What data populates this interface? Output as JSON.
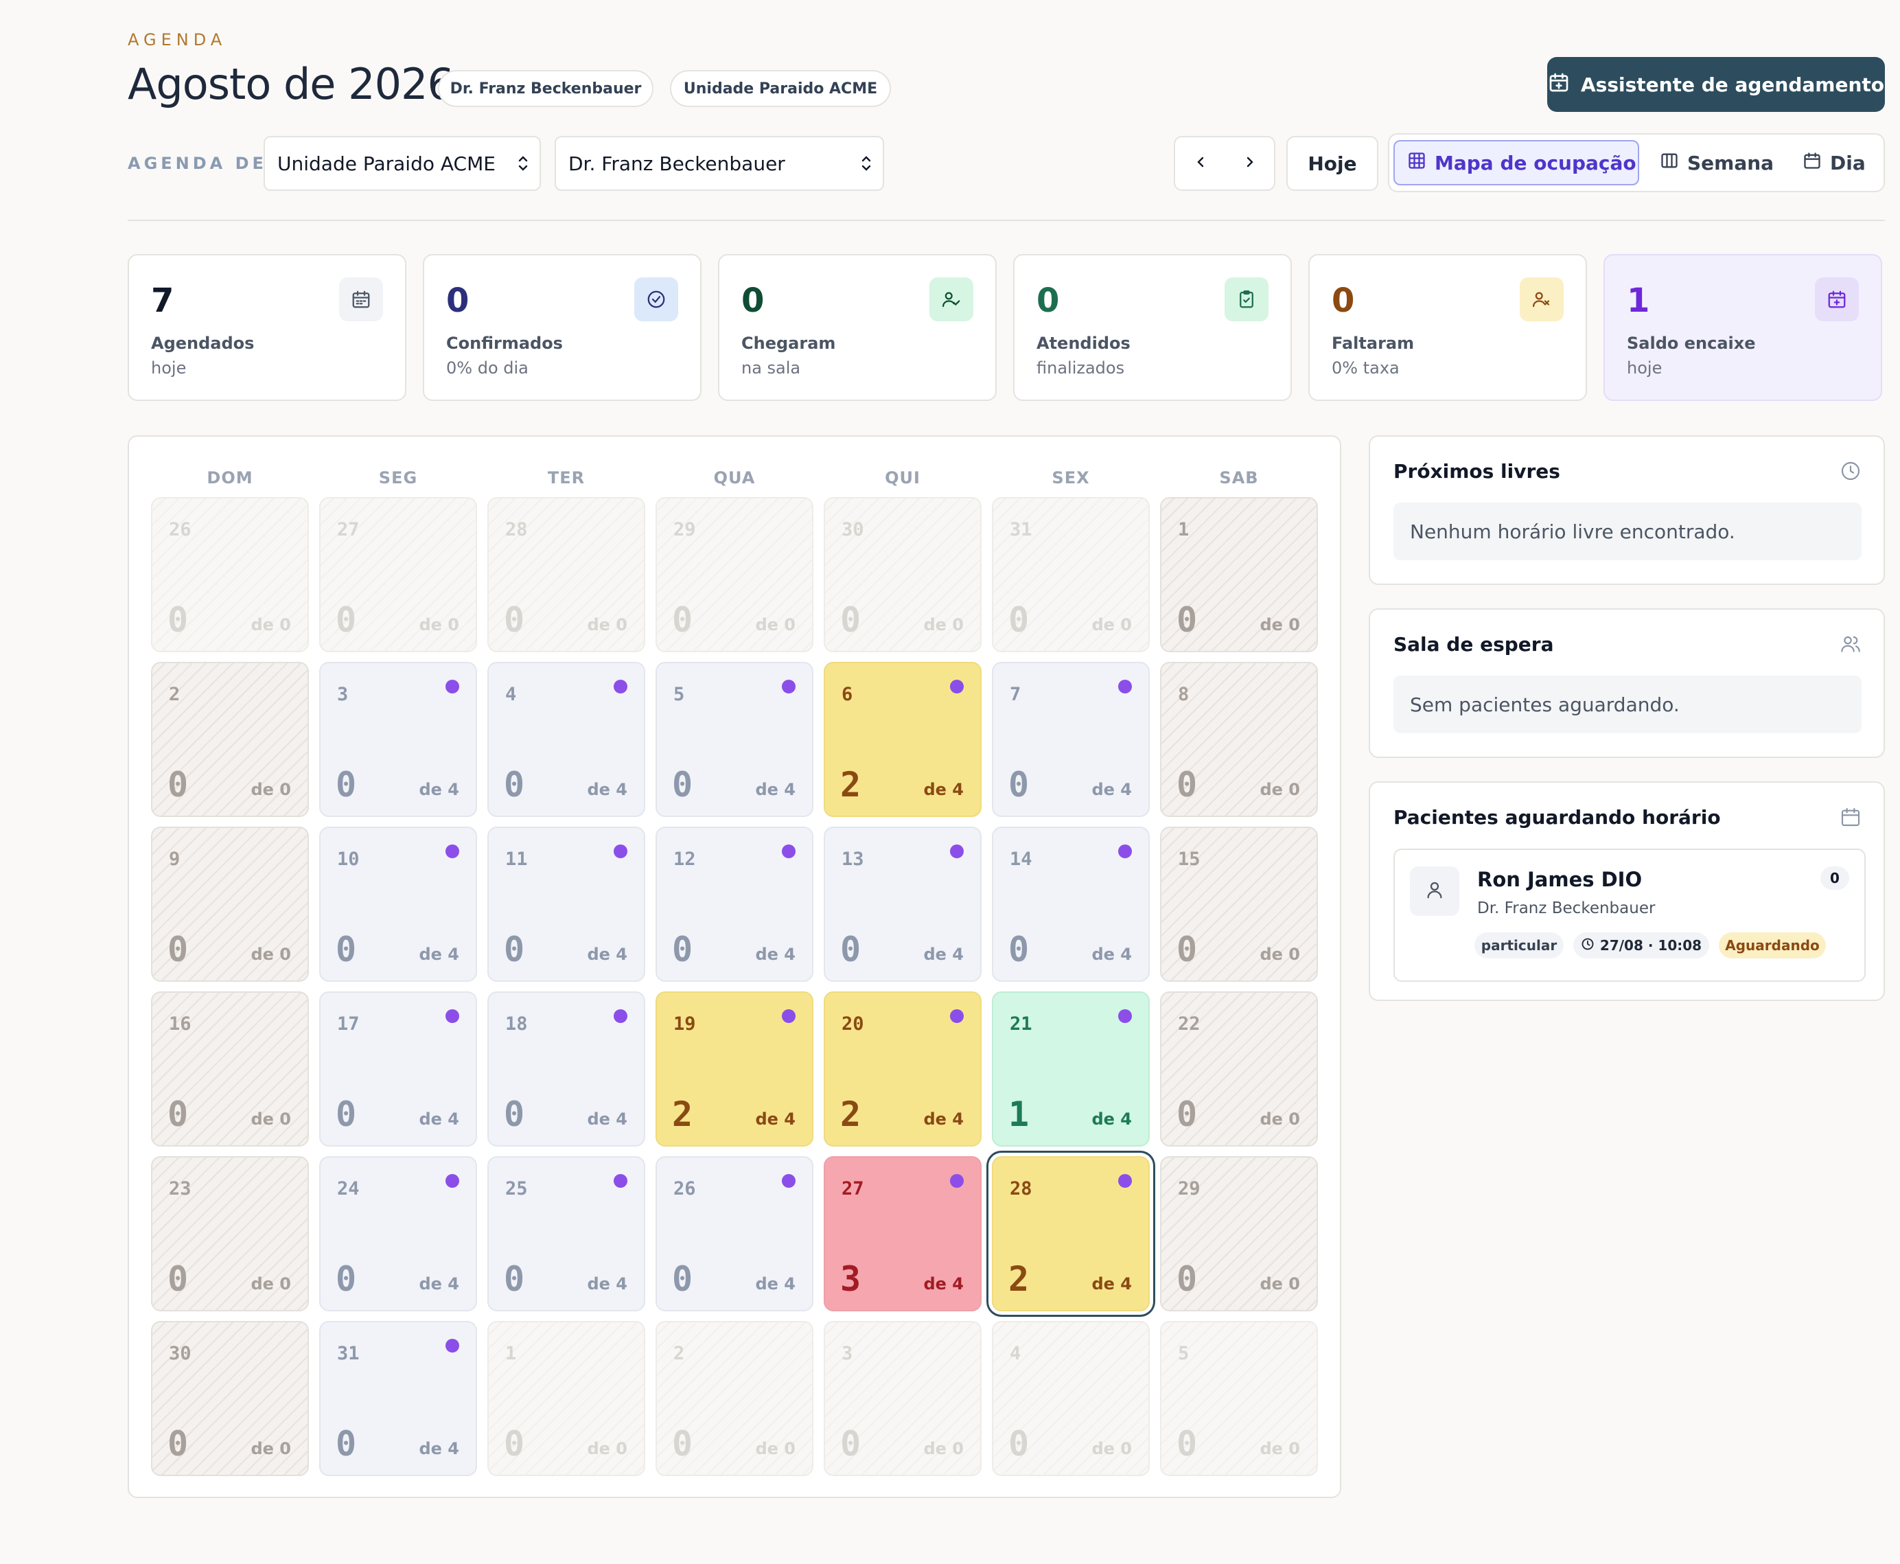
{
  "header": {
    "eyebrow": "AGENDA",
    "title": "Agosto de 2026",
    "chips": [
      "Dr. Franz Beckenbauer",
      "Unidade Paraido ACME"
    ],
    "assistant_button": "Assistente de agendamento"
  },
  "filters": {
    "label": "AGENDA DE",
    "unit_select": "Unidade Paraido ACME",
    "doctor_select": "Dr. Franz Beckenbauer"
  },
  "toolbar": {
    "today": "Hoje",
    "views": [
      {
        "label": "Mapa de ocupação",
        "icon": "grid-icon",
        "active": true
      },
      {
        "label": "Semana",
        "icon": "columns-icon",
        "active": false
      },
      {
        "label": "Dia",
        "icon": "calendar-icon",
        "active": false
      }
    ]
  },
  "stats": [
    {
      "value": "7",
      "label": "Agendados",
      "sub": "hoje",
      "color": "#111827",
      "icon": "calendar-icon",
      "icon_bg": "#f1f3f7"
    },
    {
      "value": "0",
      "label": "Confirmados",
      "sub": "0% do dia",
      "color": "#2c2f7a",
      "icon": "check-circle-icon",
      "icon_bg": "#dbe9fb"
    },
    {
      "value": "0",
      "label": "Chegaram",
      "sub": "na sala",
      "color": "#0f4d34",
      "icon": "user-check-icon",
      "icon_bg": "#d6f5e3"
    },
    {
      "value": "0",
      "label": "Atendidos",
      "sub": "finalizados",
      "color": "#1d6e4f",
      "icon": "clipboard-check-icon",
      "icon_bg": "#d6f5e3"
    },
    {
      "value": "0",
      "label": "Faltaram",
      "sub": "0% taxa",
      "color": "#8a4a12",
      "icon": "user-x-icon",
      "icon_bg": "#fbefc4"
    },
    {
      "value": "1",
      "label": "Saldo encaixe",
      "sub": "hoje",
      "color": "#6d28d9",
      "icon": "calendar-plus-icon",
      "icon_bg": "#e7defa"
    }
  ],
  "calendar": {
    "weekdays": [
      "DOM",
      "SEG",
      "TER",
      "QUA",
      "QUI",
      "SEX",
      "SAB"
    ],
    "weeks": [
      [
        {
          "day": "26",
          "count": "0",
          "of": "de 0",
          "kind": "out",
          "dot": false
        },
        {
          "day": "27",
          "count": "0",
          "of": "de 0",
          "kind": "out",
          "dot": false
        },
        {
          "day": "28",
          "count": "0",
          "of": "de 0",
          "kind": "out",
          "dot": false
        },
        {
          "day": "29",
          "count": "0",
          "of": "de 0",
          "kind": "out",
          "dot": false
        },
        {
          "day": "30",
          "count": "0",
          "of": "de 0",
          "kind": "out",
          "dot": false
        },
        {
          "day": "31",
          "count": "0",
          "of": "de 0",
          "kind": "out",
          "dot": false
        },
        {
          "day": "1",
          "count": "0",
          "of": "de 0",
          "kind": "weekend",
          "dot": false
        }
      ],
      [
        {
          "day": "2",
          "count": "0",
          "of": "de 0",
          "kind": "weekend",
          "dot": false
        },
        {
          "day": "3",
          "count": "0",
          "of": "de 4",
          "kind": "free",
          "dot": true
        },
        {
          "day": "4",
          "count": "0",
          "of": "de 4",
          "kind": "free",
          "dot": true
        },
        {
          "day": "5",
          "count": "0",
          "of": "de 4",
          "kind": "free",
          "dot": true
        },
        {
          "day": "6",
          "count": "2",
          "of": "de 4",
          "kind": "yellow",
          "dot": true
        },
        {
          "day": "7",
          "count": "0",
          "of": "de 4",
          "kind": "free",
          "dot": true
        },
        {
          "day": "8",
          "count": "0",
          "of": "de 0",
          "kind": "weekend",
          "dot": false
        }
      ],
      [
        {
          "day": "9",
          "count": "0",
          "of": "de 0",
          "kind": "weekend",
          "dot": false
        },
        {
          "day": "10",
          "count": "0",
          "of": "de 4",
          "kind": "free",
          "dot": true
        },
        {
          "day": "11",
          "count": "0",
          "of": "de 4",
          "kind": "free",
          "dot": true
        },
        {
          "day": "12",
          "count": "0",
          "of": "de 4",
          "kind": "free",
          "dot": true
        },
        {
          "day": "13",
          "count": "0",
          "of": "de 4",
          "kind": "free",
          "dot": true
        },
        {
          "day": "14",
          "count": "0",
          "of": "de 4",
          "kind": "free",
          "dot": true
        },
        {
          "day": "15",
          "count": "0",
          "of": "de 0",
          "kind": "weekend",
          "dot": false
        }
      ],
      [
        {
          "day": "16",
          "count": "0",
          "of": "de 0",
          "kind": "weekend",
          "dot": false
        },
        {
          "day": "17",
          "count": "0",
          "of": "de 4",
          "kind": "free",
          "dot": true
        },
        {
          "day": "18",
          "count": "0",
          "of": "de 4",
          "kind": "free",
          "dot": true
        },
        {
          "day": "19",
          "count": "2",
          "of": "de 4",
          "kind": "yellow",
          "dot": true
        },
        {
          "day": "20",
          "count": "2",
          "of": "de 4",
          "kind": "yellow",
          "dot": true
        },
        {
          "day": "21",
          "count": "1",
          "of": "de 4",
          "kind": "green",
          "dot": true
        },
        {
          "day": "22",
          "count": "0",
          "of": "de 0",
          "kind": "weekend",
          "dot": false
        }
      ],
      [
        {
          "day": "23",
          "count": "0",
          "of": "de 0",
          "kind": "weekend",
          "dot": false
        },
        {
          "day": "24",
          "count": "0",
          "of": "de 4",
          "kind": "free",
          "dot": true
        },
        {
          "day": "25",
          "count": "0",
          "of": "de 4",
          "kind": "free",
          "dot": true
        },
        {
          "day": "26",
          "count": "0",
          "of": "de 4",
          "kind": "free",
          "dot": true
        },
        {
          "day": "27",
          "count": "3",
          "of": "de 4",
          "kind": "red",
          "dot": true
        },
        {
          "day": "28",
          "count": "2",
          "of": "de 4",
          "kind": "yellow",
          "dot": true,
          "selected": true
        },
        {
          "day": "29",
          "count": "0",
          "of": "de 0",
          "kind": "weekend",
          "dot": false
        }
      ],
      [
        {
          "day": "30",
          "count": "0",
          "of": "de 0",
          "kind": "weekend",
          "dot": false
        },
        {
          "day": "31",
          "count": "0",
          "of": "de 4",
          "kind": "free",
          "dot": true
        },
        {
          "day": "1",
          "count": "0",
          "of": "de 0",
          "kind": "out",
          "dot": false
        },
        {
          "day": "2",
          "count": "0",
          "of": "de 0",
          "kind": "out",
          "dot": false
        },
        {
          "day": "3",
          "count": "0",
          "of": "de 0",
          "kind": "out",
          "dot": false
        },
        {
          "day": "4",
          "count": "0",
          "of": "de 0",
          "kind": "out",
          "dot": false
        },
        {
          "day": "5",
          "count": "0",
          "of": "de 0",
          "kind": "out",
          "dot": false
        }
      ]
    ]
  },
  "panels": {
    "next_free": {
      "title": "Próximos livres",
      "empty": "Nenhum horário livre encontrado.",
      "icon": "clock-icon"
    },
    "waiting_room": {
      "title": "Sala de espera",
      "empty": "Sem pacientes aguardando.",
      "icon": "users-icon"
    },
    "waiting_schedule": {
      "title": "Pacientes aguardando horário",
      "icon": "calendar-icon",
      "patient": {
        "name": "Ron James DIO",
        "doctor": "Dr. Franz Beckenbauer",
        "count": "0",
        "tag_type": "particular",
        "tag_time": "27/08 · 10:08",
        "tag_status": "Aguardando"
      }
    }
  }
}
